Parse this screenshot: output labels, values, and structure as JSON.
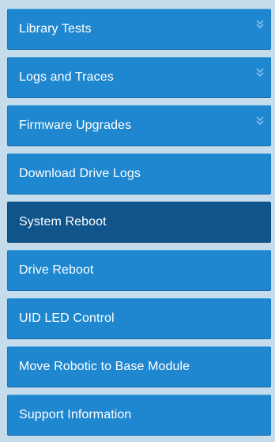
{
  "nav": {
    "items": [
      {
        "label": "Library Tests",
        "expandable": true,
        "active": false
      },
      {
        "label": "Logs and Traces",
        "expandable": true,
        "active": false
      },
      {
        "label": "Firmware Upgrades",
        "expandable": true,
        "active": false
      },
      {
        "label": "Download Drive Logs",
        "expandable": false,
        "active": false
      },
      {
        "label": "System Reboot",
        "expandable": false,
        "active": true
      },
      {
        "label": "Drive Reboot",
        "expandable": false,
        "active": false
      },
      {
        "label": "UID LED Control",
        "expandable": false,
        "active": false
      },
      {
        "label": "Move Robotic to Base Module",
        "expandable": false,
        "active": false
      },
      {
        "label": "Support Information",
        "expandable": false,
        "active": false
      }
    ]
  },
  "colors": {
    "panel_background": "#c5dcec",
    "item_background": "#1f87d0",
    "item_active_background": "#0f548a",
    "chevron_color": "#7fbde8",
    "text_color": "#ffffff"
  },
  "icons": {
    "expand": "double-chevron-down-icon"
  }
}
